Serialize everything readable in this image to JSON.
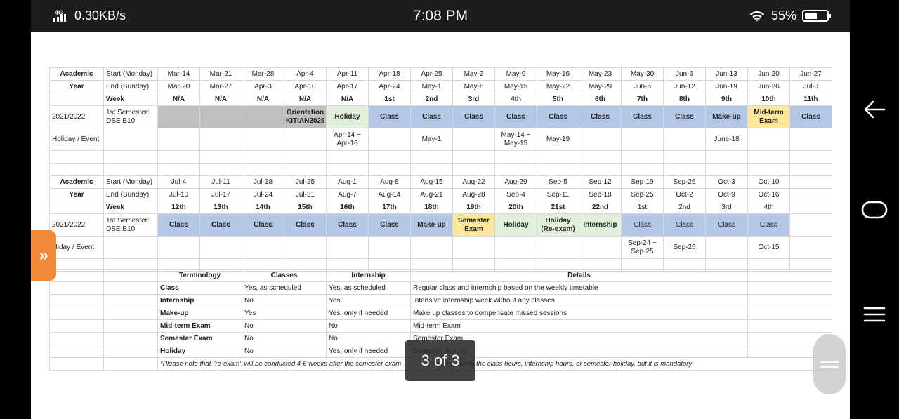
{
  "status_bar": {
    "network": "4G",
    "speed": "0.30KB/s",
    "time": "7:08 PM",
    "battery": "55%",
    "battery_level": 0.55
  },
  "schedule": {
    "header_academic": "Academic",
    "header_year": "Year",
    "label_start": "Start (Monday)",
    "label_end": "End (Sunday)",
    "label_week": "Week",
    "year_value": "2021/2022",
    "semester_label_1": "1st Semester:",
    "semester_label_2": "DSE B10",
    "holiday_event_label": "Holiday / Event",
    "holiday_event_label_clipped": "oliday / Event",
    "block1": {
      "start": [
        "Mar-14",
        "Mar-21",
        "Mar-28",
        "Apr-4",
        "Apr-11",
        "Apr-18",
        "Apr-25",
        "May-2",
        "May-9",
        "May-16",
        "May-23",
        "May-30",
        "Jun-6",
        "Jun-13",
        "Jun-20",
        "Jun-27"
      ],
      "end": [
        "Mar-20",
        "Mar-27",
        "Apr-3",
        "Apr-10",
        "Apr-17",
        "Apr-24",
        "May-1",
        "May-8",
        "May-15",
        "May-22",
        "May-29",
        "Jun-5",
        "Jun-12",
        "Jun-19",
        "Jun-26",
        "Jul-3"
      ],
      "week": [
        "N/A",
        "N/A",
        "N/A",
        "N/A",
        "N/A",
        "1st",
        "2nd",
        "3rd",
        "4th",
        "5th",
        "6th",
        "7th",
        "8th",
        "9th",
        "10th",
        "11th"
      ],
      "status": [
        "",
        "",
        "",
        "Orientation KITIAN2026",
        "Holiday",
        "Class",
        "Class",
        "Class",
        "Class",
        "Class",
        "Class",
        "Class",
        "Class",
        "Make-up",
        "Mid-term Exam",
        "Class"
      ],
      "orientation_1": "Orientation",
      "orientation_2": "KITIAN2026",
      "midterm_1": "Mid-term",
      "midterm_2": "Exam",
      "events": {
        "apr14_1": "Apr-14 ~",
        "apr14_2": "Apr-16",
        "may1": "May-1",
        "may14_1": "May-14 ~",
        "may14_2": "May-15",
        "may19": "May-19",
        "jun18": "June-18"
      }
    },
    "block2": {
      "start": [
        "Jul-4",
        "Jul-11",
        "Jul-18",
        "Jul-25",
        "Aug-1",
        "Aug-8",
        "Aug-15",
        "Aug-22",
        "Aug-29",
        "Sep-5",
        "Sep-12",
        "Sep-19",
        "Sep-26",
        "Oct-3",
        "Oct-10"
      ],
      "end": [
        "Jul-10",
        "Jul-17",
        "Jul-24",
        "Jul-31",
        "Aug-7",
        "Aug-14",
        "Aug-21",
        "Aug-28",
        "Sep-4",
        "Sep-11",
        "Sep-18",
        "Sep-25",
        "Oct-2",
        "Oct-9",
        "Oct-16"
      ],
      "week": [
        "12th",
        "13th",
        "14th",
        "15th",
        "16th",
        "17th",
        "18th",
        "19th",
        "20th",
        "21st",
        "22nd",
        "1st",
        "2nd",
        "3rd",
        "4th"
      ],
      "status": [
        "Class",
        "Class",
        "Class",
        "Class",
        "Class",
        "Class",
        "Make-up",
        "Semester Exam",
        "Holiday",
        "Holiday (Re-exam)",
        "Internship",
        "Class",
        "Class",
        "Class",
        "Class"
      ],
      "sem_exam_1": "Semester",
      "sem_exam_2": "Exam",
      "reexam_1": "Holiday",
      "reexam_2": "(Re-exam)",
      "events": {
        "sep24_1": "Sep-24 ~",
        "sep24_2": "Sep-25",
        "sep26": "Sep-26",
        "oct15": "Oct-15"
      }
    }
  },
  "terminology": {
    "headers": [
      "Terminology",
      "Classes",
      "Internship",
      "Details"
    ],
    "rows": [
      {
        "term": "Class",
        "classes": "Yes, as scheduled",
        "internship": "Yes, as scheduled",
        "details": "Regular class and internship based on the weekly timetable"
      },
      {
        "term": "Internship",
        "classes": "No",
        "internship": "Yes",
        "details": "Intensive internship week without any classes"
      },
      {
        "term": "Make-up",
        "classes": "Yes",
        "internship": "Yes, only if needed",
        "details": "Make up classes to compensate missed sessions"
      },
      {
        "term": "Mid-term Exam",
        "classes": "No",
        "internship": "No",
        "details": "Mid-term Exam"
      },
      {
        "term": "Semester Exam",
        "classes": "No",
        "internship": "No",
        "details": "Semester Exam"
      },
      {
        "term": "Holiday",
        "classes": "No",
        "internship": "Yes, only if needed",
        "details": "Semester holiday"
      }
    ],
    "note": "*Please note that \"re-exam\" will be conducted 4-6 weeks after the semester exam",
    "note_tail": "verlapped to the class hours, internship hours, or semester holiday, but it is mandatory"
  },
  "overlay": {
    "page_indicator": "3 of 3",
    "side_tab_glyph": "»"
  },
  "icons": {
    "back": "arrow-left-icon",
    "home": "home-pill-icon",
    "recents": "menu-lines-icon",
    "wifi": "wifi-icon",
    "battery": "battery-icon",
    "signal": "signal-icon"
  }
}
